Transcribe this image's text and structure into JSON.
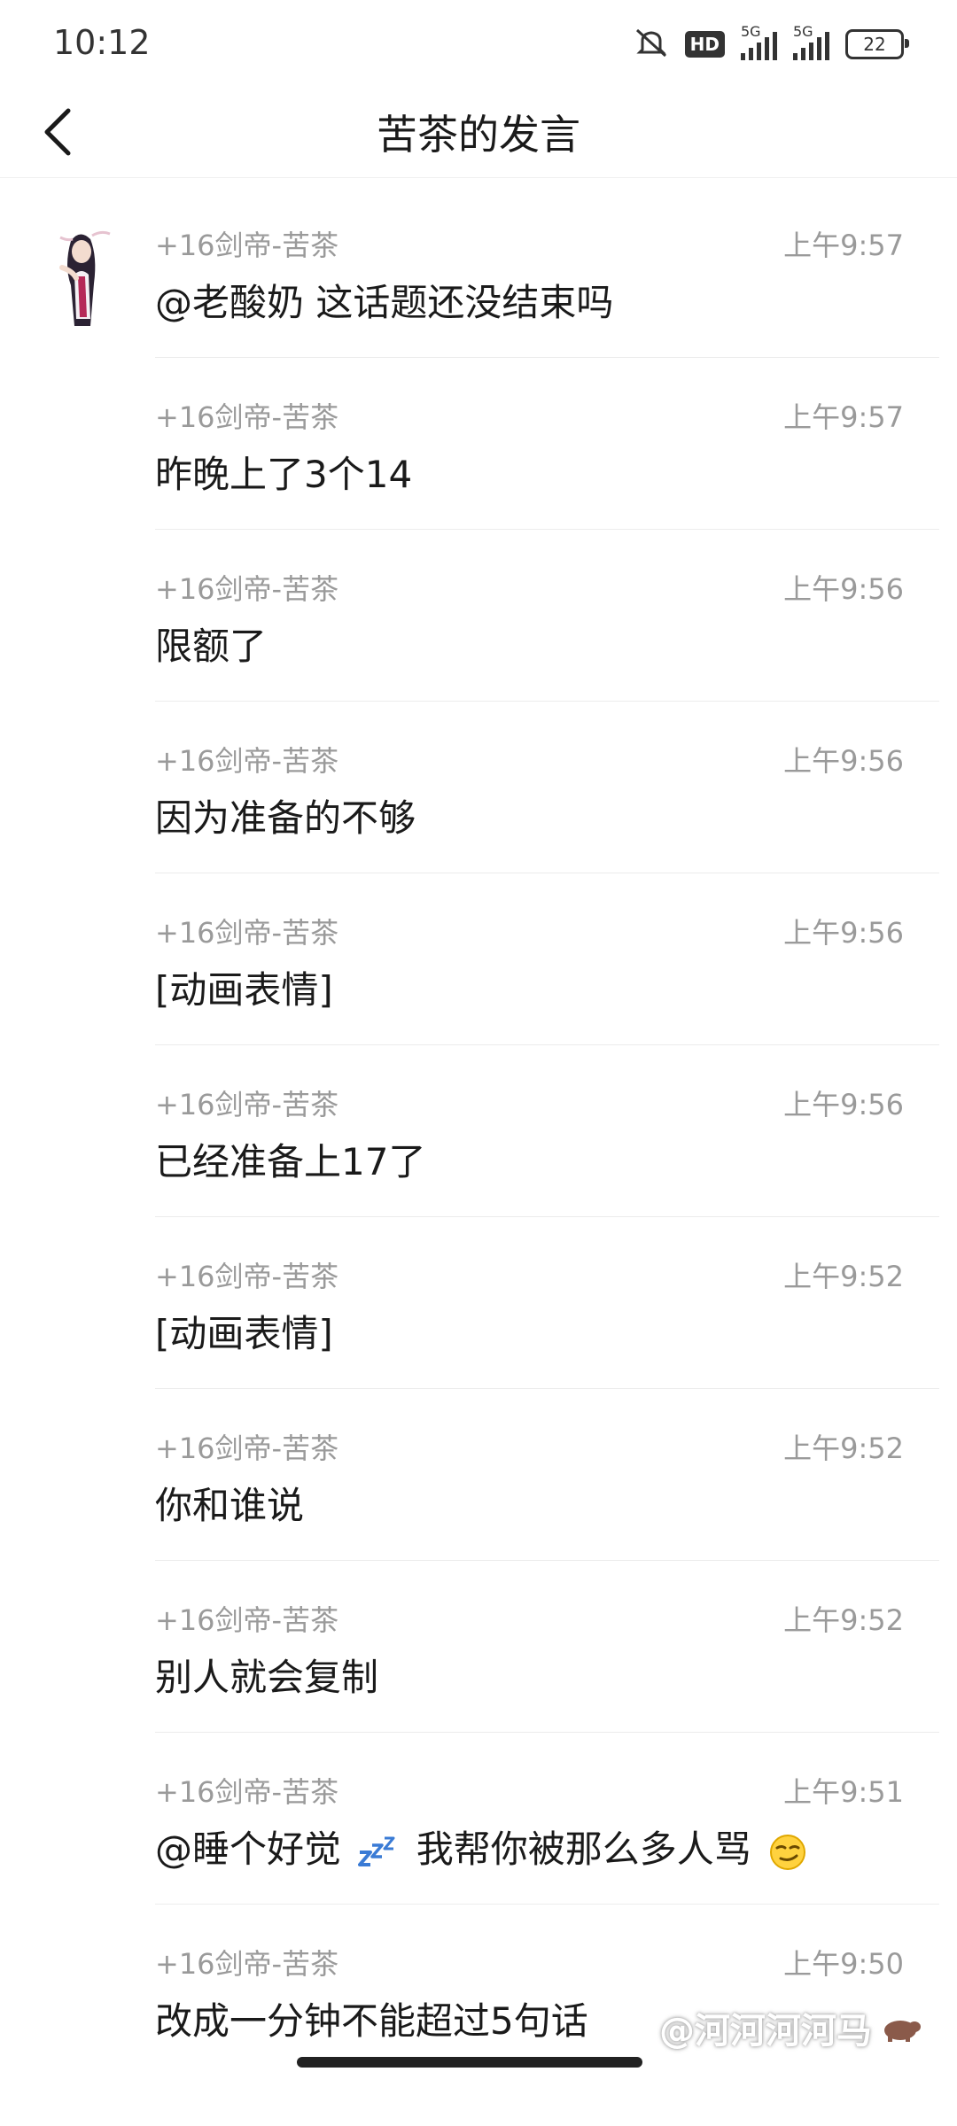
{
  "status": {
    "time": "10:12",
    "hd_badge": "HD",
    "net1": "5G",
    "net2": "5G",
    "battery": "22"
  },
  "header": {
    "title": "苦茶的发言",
    "back_icon": "chevron-left-icon"
  },
  "messages": [
    {
      "sender": "+16剑帝-苦茶",
      "time": "上午9:57",
      "content": "@老酸奶 这话题还没结束吗"
    },
    {
      "sender": "+16剑帝-苦茶",
      "time": "上午9:57",
      "content": "昨晚上了3个14"
    },
    {
      "sender": "+16剑帝-苦茶",
      "time": "上午9:56",
      "content": "限额了"
    },
    {
      "sender": "+16剑帝-苦茶",
      "time": "上午9:56",
      "content": "因为准备的不够"
    },
    {
      "sender": "+16剑帝-苦茶",
      "time": "上午9:56",
      "content": "[动画表情]"
    },
    {
      "sender": "+16剑帝-苦茶",
      "time": "上午9:56",
      "content": "已经准备上17了"
    },
    {
      "sender": "+16剑帝-苦茶",
      "time": "上午9:52",
      "content": "[动画表情]"
    },
    {
      "sender": "+16剑帝-苦茶",
      "time": "上午9:52",
      "content": "你和谁说"
    },
    {
      "sender": "+16剑帝-苦茶",
      "time": "上午9:52",
      "content": "别人就会复制"
    },
    {
      "sender": "+16剑帝-苦茶",
      "time": "上午9:51",
      "content_a": "@睡个好觉",
      "content_b": " 我帮你被那么多人骂"
    },
    {
      "sender": "+16剑帝-苦茶",
      "time": "上午9:50",
      "content": "改成一分钟不能超过5句话"
    }
  ],
  "watermark": "@河河河河马"
}
